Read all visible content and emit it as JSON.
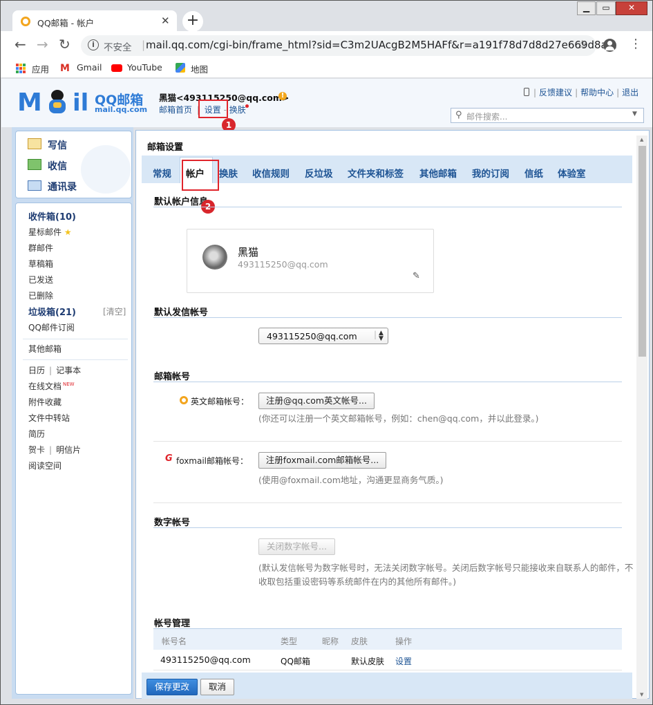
{
  "browser": {
    "tab_title": "QQ邮箱 - 帐户",
    "insecure_label": "不安全",
    "url": "mail.qq.com/cgi-bin/frame_html?sid=C3m2UAcgB2M5HAFf&r=a191f78d7d8d27e669d8a...",
    "bookmarks": [
      "应用",
      "Gmail",
      "YouTube",
      "地图"
    ]
  },
  "header": {
    "logo_text": "QQ邮箱",
    "logo_sub": "mail.qq.com",
    "user": "黑猫<493115250@qq.com>",
    "nav_home": "邮箱首页",
    "nav_settings": "设置",
    "nav_skin": "换肤",
    "nav_dash": "-",
    "feedback": "反馈建议",
    "help": "帮助中心",
    "logout": "退出",
    "search_placeholder": "邮件搜索..."
  },
  "sidebar": {
    "compose": "写信",
    "receive": "收信",
    "contacts": "通讯录",
    "inbox": "收件箱(10)",
    "starred": "星标邮件",
    "group": "群邮件",
    "drafts": "草稿箱",
    "sent": "已发送",
    "deleted": "已删除",
    "junk": "垃圾箱(21)",
    "clear": "[清空]",
    "subscribe": "QQ邮件订阅",
    "other": "其他邮箱",
    "calendar": "日历",
    "notes": "记事本",
    "docs": "在线文档",
    "new_tag": "NEW",
    "attach": "附件收藏",
    "transfer": "文件中转站",
    "resume": "简历",
    "card": "贺卡",
    "postcard": "明信片",
    "reading": "阅读空间"
  },
  "main": {
    "title": "邮箱设置",
    "tabs": [
      "常规",
      "帐户",
      "换肤",
      "收信规则",
      "反垃圾",
      "文件夹和标签",
      "其他邮箱",
      "我的订阅",
      "信纸",
      "体验室"
    ],
    "default_info_title": "默认帐户信息",
    "profile_name": "黑猫",
    "profile_email": "493115250@qq.com",
    "default_send_title": "默认发信帐号",
    "default_send_value": "493115250@qq.com",
    "mail_account_title": "邮箱帐号",
    "en_label": "英文邮箱帐号：",
    "en_button": "注册@qq.com英文帐号...",
    "en_hint": "(你还可以注册一个英文邮箱帐号，例如：chen@qq.com，并以此登录。)",
    "fox_label": "foxmail邮箱帐号：",
    "fox_button": "注册foxmail.com邮箱帐号...",
    "fox_hint": "(使用@foxmail.com地址，沟通更显商务气质。)",
    "digit_title": "数字帐号",
    "digit_button": "关闭数字帐号...",
    "digit_hint1": "(默认发信帐号为数字帐号时，无法关闭数字帐号。关闭后数字帐号只能接收来自联系人的邮件，不",
    "digit_hint2": "收取包括重设密码等系统邮件在内的其他所有邮件。)",
    "manage_title": "帐号管理",
    "table_headers": [
      "帐号名",
      "类型",
      "昵称",
      "皮肤",
      "操作"
    ],
    "table_row": [
      "493115250@qq.com",
      "QQ邮箱",
      "",
      "默认皮肤",
      "设置"
    ],
    "save": "保存更改",
    "cancel": "取消"
  },
  "annotations": [
    "1",
    "2"
  ],
  "colors": {
    "accent": "#1e5494",
    "tabbar": "#d8e7f6",
    "save_button": "#2d7cd1",
    "marker": "#d8262c"
  }
}
